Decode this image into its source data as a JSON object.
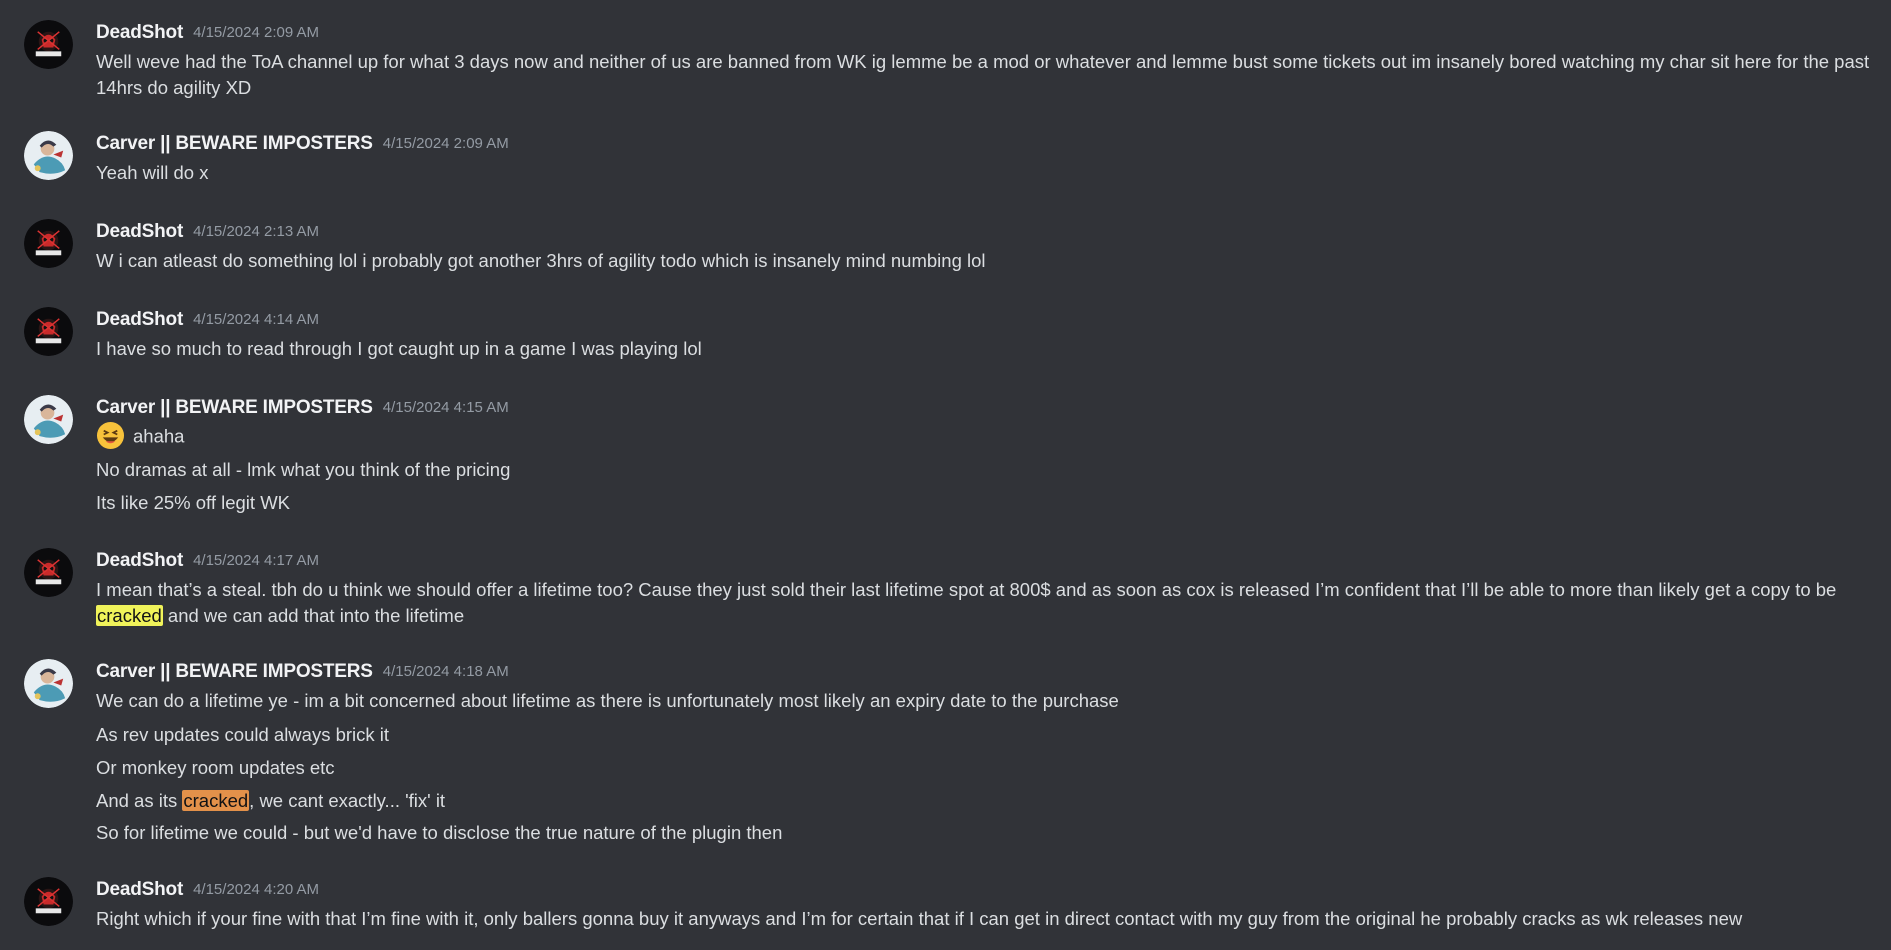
{
  "messages": [
    {
      "author": "DeadShot",
      "timestamp": "4/15/2024 2:09 AM",
      "lines": [
        "Well weve had the ToA channel up for what 3 days now and neither of us are banned from WK ig lemme be a mod or whatever and lemme bust some tickets out im insanely bored watching my char sit here for the past 14hrs do agility XD"
      ]
    },
    {
      "author": "Carver || BEWARE IMPOSTERS",
      "timestamp": "4/15/2024 2:09 AM",
      "lines": [
        "Yeah will do x"
      ]
    },
    {
      "author": "DeadShot",
      "timestamp": "4/15/2024 2:13 AM",
      "lines": [
        "W i can atleast do something lol i probably got another 3hrs of agility todo which is insanely mind numbing lol"
      ]
    },
    {
      "author": "DeadShot",
      "timestamp": "4/15/2024 4:14 AM",
      "lines": [
        "I have so much to read through I got caught up in a game I was playing lol"
      ]
    },
    {
      "author": "Carver || BEWARE IMPOSTERS",
      "timestamp": "4/15/2024 4:15 AM",
      "emoji": "laughing-emoji",
      "lines": [
        "ahaha",
        "No dramas at all - lmk what you think of the pricing",
        "Its like 25% off legit WK"
      ]
    },
    {
      "author": "DeadShot",
      "timestamp": "4/15/2024 4:17 AM",
      "lines": [
        {
          "before": "I mean that’s a steal. tbh do u think we should offer a lifetime too? Cause they just sold their last lifetime spot at 800$ and as soon as cox is released I’m confident that I’ll be able to more than likely get a copy to be ",
          "highlight": "cracked",
          "after": " and we can add that into the lifetime"
        }
      ]
    },
    {
      "author": "Carver || BEWARE IMPOSTERS",
      "timestamp": "4/15/2024 4:18 AM",
      "lines": [
        "We can do a lifetime ye - im a bit concerned about lifetime as there is unfortunately most likely an expiry date to the purchase",
        "As rev updates could always brick it",
        "Or monkey room updates etc",
        {
          "before": "And as its ",
          "highlight": "cracked",
          "after": ", we cant exactly... 'fix' it"
        },
        "So for lifetime we could - but we'd have to disclose the true nature of the plugin then"
      ]
    },
    {
      "author": "DeadShot",
      "timestamp": "4/15/2024 4:20 AM",
      "lines": [
        "Right which if your fine with that I’m fine with it, only ballers gonna buy it anyways and I’m for certain that if I can get in direct contact with my guy from the original he probably cracks as wk releases new"
      ]
    }
  ],
  "colors": {
    "background": "#313338",
    "text": "#dbdee1",
    "username": "#f2f3f5",
    "timestamp": "#949ba4",
    "highlight_yellow": "#f0f35a",
    "highlight_orange": "#e3914a"
  }
}
